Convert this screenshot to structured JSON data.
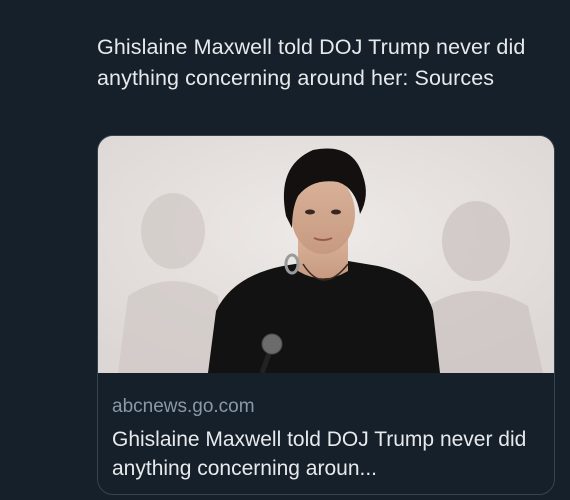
{
  "tweet": {
    "text": "Ghislaine Maxwell told DOJ Trump never did anything concerning around her: Sources"
  },
  "link_card": {
    "image_alt": "Ghislaine Maxwell",
    "domain": "abcnews.go.com",
    "title": "Ghislaine Maxwell told DOJ Trump never did anything concerning aroun..."
  }
}
